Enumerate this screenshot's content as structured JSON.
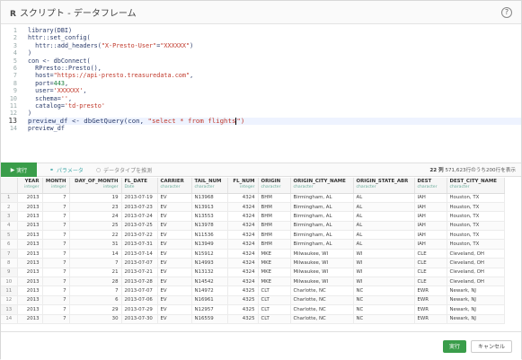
{
  "window": {
    "title_prefix": "R",
    "title": "スクリプト - データフレーム",
    "help_label": "?"
  },
  "editor": {
    "line_numbers": [
      "1",
      "2",
      "3",
      "4",
      "5",
      "6",
      "7",
      "8",
      "9",
      "10",
      "11",
      "12",
      "13",
      "14"
    ],
    "current_line": "13",
    "lines": [
      [
        {
          "t": "library(DBI)",
          "c": "kw"
        }
      ],
      [
        {
          "t": "httr::set_config(",
          "c": "kw"
        }
      ],
      [
        {
          "t": "  httr::add_headers(",
          "c": "kw"
        },
        {
          "t": "\"X-Presto-User\"",
          "c": "str"
        },
        {
          "t": "=",
          "c": "kw"
        },
        {
          "t": "\"XXXXXX\"",
          "c": "str"
        },
        {
          "t": ")",
          "c": "kw"
        }
      ],
      [
        {
          "t": ")",
          "c": "kw"
        }
      ],
      [
        {
          "t": "con <- dbConnect(",
          "c": "kw"
        }
      ],
      [
        {
          "t": "  RPresto::Presto(),",
          "c": "kw"
        }
      ],
      [
        {
          "t": "  host=",
          "c": "kw"
        },
        {
          "t": "\"https://api-presto.treasuredata.com\"",
          "c": "str"
        },
        {
          "t": ",",
          "c": "kw"
        }
      ],
      [
        {
          "t": "  port=",
          "c": "kw"
        },
        {
          "t": "443",
          "c": "num"
        },
        {
          "t": ",",
          "c": "kw"
        }
      ],
      [
        {
          "t": "  user=",
          "c": "kw"
        },
        {
          "t": "'XXXXXX'",
          "c": "str"
        },
        {
          "t": ",",
          "c": "kw"
        }
      ],
      [
        {
          "t": "  schema=",
          "c": "kw"
        },
        {
          "t": "''",
          "c": "str"
        },
        {
          "t": ",",
          "c": "kw"
        }
      ],
      [
        {
          "t": "  catalog=",
          "c": "kw"
        },
        {
          "t": "'td-presto'",
          "c": "str"
        }
      ],
      [
        {
          "t": ")",
          "c": "kw"
        }
      ],
      [
        {
          "t": "preview_df <- dbGetQuery(con, ",
          "c": "kw"
        },
        {
          "t": "\"select * from flights",
          "c": "str"
        },
        {
          "t": "|",
          "c": "cursor"
        },
        {
          "t": "\")",
          "c": "str"
        }
      ],
      [
        {
          "t": "preview_df",
          "c": "kw"
        }
      ]
    ]
  },
  "toolbar": {
    "run_label": "実行",
    "params_label": "パラメータ",
    "type_infer_label": "データタイプを推測",
    "stats_cols": "22 列",
    "stats_rows": "571,623行のうち200行を表示"
  },
  "grid": {
    "columns": [
      {
        "name": "YEAR",
        "type": "integer",
        "w": 28
      },
      {
        "name": "MONTH",
        "type": "integer",
        "w": 30
      },
      {
        "name": "DAY_OF_MONTH",
        "type": "integer",
        "w": 58
      },
      {
        "name": "FL_DATE",
        "type": "Date",
        "w": 40
      },
      {
        "name": "CARRIER",
        "type": "character",
        "w": 38
      },
      {
        "name": "TAIL_NUM",
        "type": "character",
        "w": 40
      },
      {
        "name": "FL_NUM",
        "type": "integer",
        "w": 34
      },
      {
        "name": "ORIGIN",
        "type": "character",
        "w": 36
      },
      {
        "name": "ORIGIN_CITY_NAME",
        "type": "character",
        "w": 70
      },
      {
        "name": "ORIGIN_STATE_ABR",
        "type": "character",
        "w": 68
      },
      {
        "name": "DEST",
        "type": "character",
        "w": 36
      },
      {
        "name": "DEST_CITY_NAME",
        "type": "character",
        "w": 64
      }
    ],
    "right_aligned": [
      0,
      1,
      2,
      6
    ],
    "rows": [
      [
        "1",
        "2013",
        "7",
        "19",
        "2013-07-19",
        "EV",
        "N13968",
        "4324",
        "BHM",
        "Birmingham, AL",
        "AL",
        "IAH",
        "Houston, TX"
      ],
      [
        "2",
        "2013",
        "7",
        "23",
        "2013-07-23",
        "EV",
        "N13913",
        "4324",
        "BHM",
        "Birmingham, AL",
        "AL",
        "IAH",
        "Houston, TX"
      ],
      [
        "3",
        "2013",
        "7",
        "24",
        "2013-07-24",
        "EV",
        "N13553",
        "4324",
        "BHM",
        "Birmingham, AL",
        "AL",
        "IAH",
        "Houston, TX"
      ],
      [
        "4",
        "2013",
        "7",
        "25",
        "2013-07-25",
        "EV",
        "N13978",
        "4324",
        "BHM",
        "Birmingham, AL",
        "AL",
        "IAH",
        "Houston, TX"
      ],
      [
        "5",
        "2013",
        "7",
        "22",
        "2013-07-22",
        "EV",
        "N11536",
        "4324",
        "BHM",
        "Birmingham, AL",
        "AL",
        "IAH",
        "Houston, TX"
      ],
      [
        "6",
        "2013",
        "7",
        "31",
        "2013-07-31",
        "EV",
        "N13949",
        "4324",
        "BHM",
        "Birmingham, AL",
        "AL",
        "IAH",
        "Houston, TX"
      ],
      [
        "7",
        "2013",
        "7",
        "14",
        "2013-07-14",
        "EV",
        "N15912",
        "4324",
        "MKE",
        "Milwaukee, WI",
        "WI",
        "CLE",
        "Cleveland, OH"
      ],
      [
        "8",
        "2013",
        "7",
        "7",
        "2013-07-07",
        "EV",
        "N14993",
        "4324",
        "MKE",
        "Milwaukee, WI",
        "WI",
        "CLE",
        "Cleveland, OH"
      ],
      [
        "9",
        "2013",
        "7",
        "21",
        "2013-07-21",
        "EV",
        "N13132",
        "4324",
        "MKE",
        "Milwaukee, WI",
        "WI",
        "CLE",
        "Cleveland, OH"
      ],
      [
        "10",
        "2013",
        "7",
        "28",
        "2013-07-28",
        "EV",
        "N14542",
        "4324",
        "MKE",
        "Milwaukee, WI",
        "WI",
        "CLE",
        "Cleveland, OH"
      ],
      [
        "11",
        "2013",
        "7",
        "7",
        "2013-07-07",
        "EV",
        "N14972",
        "4325",
        "CLT",
        "Charlotte, NC",
        "NC",
        "EWR",
        "Newark, NJ"
      ],
      [
        "12",
        "2013",
        "7",
        "6",
        "2013-07-06",
        "EV",
        "N16961",
        "4325",
        "CLT",
        "Charlotte, NC",
        "NC",
        "EWR",
        "Newark, NJ"
      ],
      [
        "13",
        "2013",
        "7",
        "29",
        "2013-07-29",
        "EV",
        "N12957",
        "4325",
        "CLT",
        "Charlotte, NC",
        "NC",
        "EWR",
        "Newark, NJ"
      ],
      [
        "14",
        "2013",
        "7",
        "30",
        "2013-07-30",
        "EV",
        "N16559",
        "4325",
        "CLT",
        "Charlotte, NC",
        "NC",
        "EWR",
        "Newark, NJ"
      ]
    ]
  },
  "footer": {
    "ok_label": "実行",
    "cancel_label": "キャンセル"
  }
}
